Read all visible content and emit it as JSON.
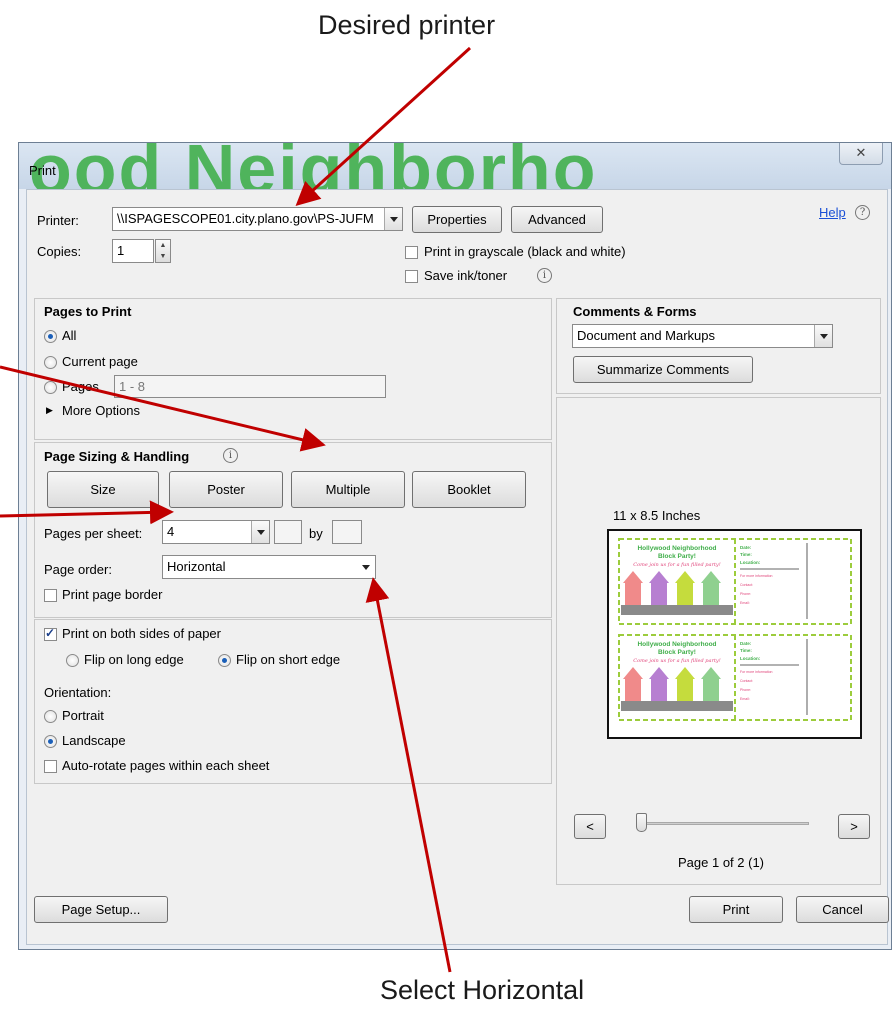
{
  "annotations": {
    "top": "Desired printer",
    "bottom": "Select Horizontal"
  },
  "dialog": {
    "title": "Print",
    "background_text": "ood Neighborho",
    "close": "✕",
    "help": "Help",
    "help_icon": "?"
  },
  "printer": {
    "label": "Printer:",
    "value": "\\\\ISPAGESCOPE01.city.plano.gov\\PS-JUFM",
    "properties": "Properties",
    "advanced": "Advanced",
    "copies_label": "Copies:",
    "copies_value": "1",
    "grayscale": "Print in grayscale (black and white)",
    "save_ink": "Save ink/toner",
    "info": "i"
  },
  "pages_to_print": {
    "heading": "Pages to Print",
    "all": "All",
    "current": "Current page",
    "pages": "Pages",
    "pages_range": "1 - 8",
    "more": "More Options",
    "more_icon": "▶"
  },
  "sizing": {
    "heading": "Page Sizing & Handling",
    "size": "Size",
    "poster": "Poster",
    "multiple": "Multiple",
    "booklet": "Booklet",
    "per_sheet_label": "Pages per sheet:",
    "per_sheet_value": "4",
    "by": "by",
    "order_label": "Page order:",
    "order_value": "Horizontal",
    "border": "Print page border"
  },
  "duplex": {
    "both_sides": "Print on both sides of paper",
    "long_edge": "Flip on long edge",
    "short_edge": "Flip on short edge",
    "orientation_label": "Orientation:",
    "portrait": "Portrait",
    "landscape": "Landscape",
    "auto_rotate": "Auto-rotate pages within each sheet"
  },
  "comments": {
    "heading": "Comments & Forms",
    "value": "Document and Markups",
    "summarize": "Summarize Comments"
  },
  "preview": {
    "size": "11 x 8.5 Inches",
    "prev": "<",
    "next": ">",
    "page_status": "Page 1 of 2 (1)",
    "flyer": {
      "title1": "Hollywood Neighborhood",
      "title2": "Block Party!",
      "tagline": "Come join us for a fun filled party!",
      "date": "Date:",
      "time": "Time:",
      "location": "Location:",
      "rsvp": "For more information",
      "contact": "Contact:",
      "phone": "Phone:",
      "email": "Email:"
    }
  },
  "footer": {
    "page_setup": "Page Setup...",
    "print": "Print",
    "cancel": "Cancel"
  },
  "colors": {
    "arrow": "#c00000",
    "flyer_green": "#3fae49",
    "flyer_pink": "#e0447a"
  }
}
